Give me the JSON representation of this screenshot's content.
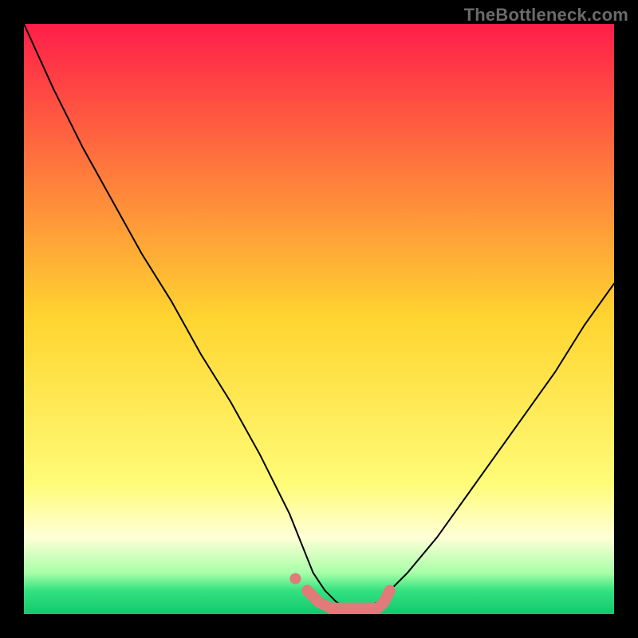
{
  "watermark": "TheBottleneck.com",
  "chart_data": {
    "type": "line",
    "title": "",
    "xlabel": "",
    "ylabel": "",
    "xlim": [
      0,
      100
    ],
    "ylim": [
      0,
      100
    ],
    "grid": false,
    "background_gradient_stops": [
      {
        "offset": 0.0,
        "color": "#FF1E49"
      },
      {
        "offset": 0.5,
        "color": "#FFD530"
      },
      {
        "offset": 0.78,
        "color": "#FFFC78"
      },
      {
        "offset": 0.87,
        "color": "#FFFFD7"
      },
      {
        "offset": 0.93,
        "color": "#A8FFA8"
      },
      {
        "offset": 0.96,
        "color": "#34E27F"
      },
      {
        "offset": 1.0,
        "color": "#12C86E"
      }
    ],
    "series": [
      {
        "name": "bottleneck-curve",
        "color": "#000000",
        "x": [
          0,
          5,
          10,
          15,
          20,
          25,
          30,
          35,
          40,
          45,
          47,
          49,
          51,
          53,
          55,
          57,
          60,
          65,
          70,
          75,
          80,
          85,
          90,
          95,
          100
        ],
        "values": [
          100,
          89,
          79,
          70,
          61,
          53,
          44,
          36,
          27,
          17,
          12,
          7,
          4,
          2,
          1,
          1,
          2,
          7,
          13,
          20,
          27,
          34,
          41,
          49,
          56
        ]
      },
      {
        "name": "optimal-flat-segment",
        "color": "#E07B7A",
        "style": "thick-dots",
        "x": [
          48,
          50,
          52,
          54,
          56,
          58,
          60,
          61,
          62
        ],
        "values": [
          4,
          2,
          1,
          1,
          1,
          1,
          1,
          2,
          4
        ]
      },
      {
        "name": "optimal-marker",
        "color": "#E07B7A",
        "style": "dot",
        "x": [
          46
        ],
        "values": [
          6
        ]
      }
    ]
  }
}
